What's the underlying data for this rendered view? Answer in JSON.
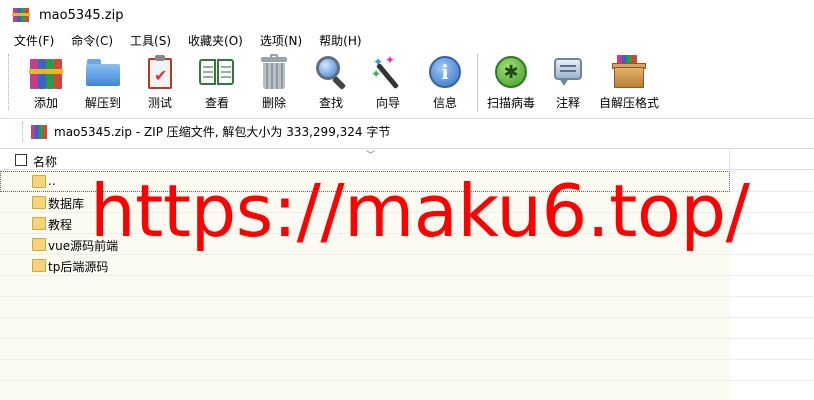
{
  "window": {
    "title": "mao5345.zip"
  },
  "menu": [
    "文件(F)",
    "命令(C)",
    "工具(S)",
    "收藏夹(O)",
    "选项(N)",
    "帮助(H)"
  ],
  "toolbar": {
    "add": "添加",
    "extract_to": "解压到",
    "test": "测试",
    "view": "查看",
    "delete": "删除",
    "find": "查找",
    "wizard": "向导",
    "info": "信息",
    "virus_scan": "扫描病毒",
    "comment": "注释",
    "sfx": "自解压格式"
  },
  "address": {
    "text": "mao5345.zip - ZIP 压缩文件, 解包大小为 333,299,324 字节"
  },
  "list": {
    "column_name": "名称",
    "rows": [
      "..",
      "数据库",
      "教程",
      "vue源码前端",
      "tp后端源码"
    ]
  },
  "watermark": "https://maku6.top/",
  "colors": {
    "watermark": "#ff0000",
    "list_bg": "#fcfbf2"
  }
}
